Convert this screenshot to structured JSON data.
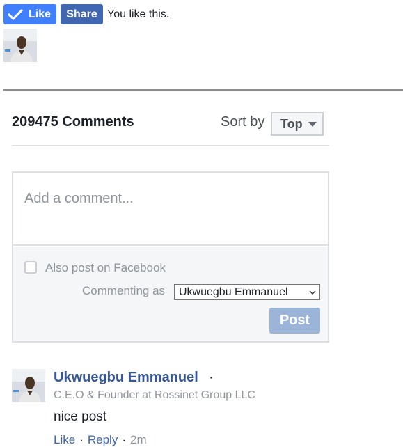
{
  "like_bar": {
    "like_label": "Like",
    "share_label": "Share",
    "like_status": "You like this.",
    "colors": {
      "like": "#4080ff",
      "share": "#4267b2"
    }
  },
  "comments": {
    "count_label": "209475 Comments",
    "sort_label": "Sort by",
    "sort_value": "Top"
  },
  "composer": {
    "placeholder": "Add a comment...",
    "also_post_label": "Also post on Facebook",
    "commenting_as_label": "Commenting as",
    "commenting_as_value": "Ukwuegbu Emmanuel",
    "post_label": "Post"
  },
  "comment_list": [
    {
      "author": "Ukwuegbu Emmanuel",
      "separator": "·",
      "author_title": "C.E.O & Founder at Rossinet Group LLC",
      "text": "nice post",
      "like_label": "Like",
      "reply_label": "Reply",
      "time": "2m"
    }
  ]
}
